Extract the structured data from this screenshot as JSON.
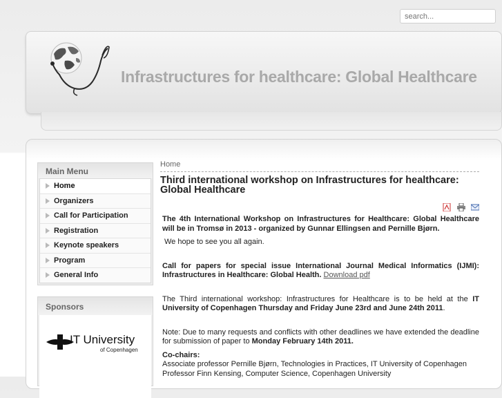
{
  "search": {
    "placeholder": "search..."
  },
  "header": {
    "title": "Infrastructures for healthcare: Global Healthcare"
  },
  "main_menu": {
    "title": "Main Menu",
    "items": [
      {
        "label": "Home",
        "active": true
      },
      {
        "label": "Organizers"
      },
      {
        "label": "Call for Participation"
      },
      {
        "label": "Registration"
      },
      {
        "label": "Keynote speakers"
      },
      {
        "label": "Program"
      },
      {
        "label": "General Info"
      }
    ]
  },
  "sponsors": {
    "title": "Sponsors",
    "itu_name": "IT University",
    "itu_sub": "of Copenhagen"
  },
  "breadcrumb": "Home",
  "article": {
    "title": "Third international workshop on Infrastructures for healthcare: Global Healthcare",
    "icons": [
      "pdf-icon",
      "print-icon",
      "email-icon"
    ],
    "p1": "The 4th International Workshop on Infrastructures for Healthcare: Global Healthcare will be in Tromsø in 2013 - organized by Gunnar Ellingsen and Pernille Bjørn.",
    "p2": "We hope to see you all again.",
    "p3": "Call for papers for special issue International Journal Medical Informatics (IJMI): Infrastructures in Healthcare: Global Health.",
    "p3_link": "Download pdf",
    "p4_a": "The Third international workshop: Infrastructures for Healthcare is to be held at the",
    "p4_b": "IT University of Copenhagen Thursday and Friday June 23rd and June 24th 2011",
    "p4_c": ".",
    "p5_a": "Note: Due to many requests and conflicts with other deadlines we have extended the deadline for submission of paper to",
    "p5_b": "Monday February 14th 2011.",
    "cochairs_label": "Co-chairs:",
    "cochair1": "Associate professor Pernille Bjørn, Technologies in Practices, IT University of Copenhagen",
    "cochair2": "Professor Finn Kensing, Computer Science, Copenhagen University"
  }
}
